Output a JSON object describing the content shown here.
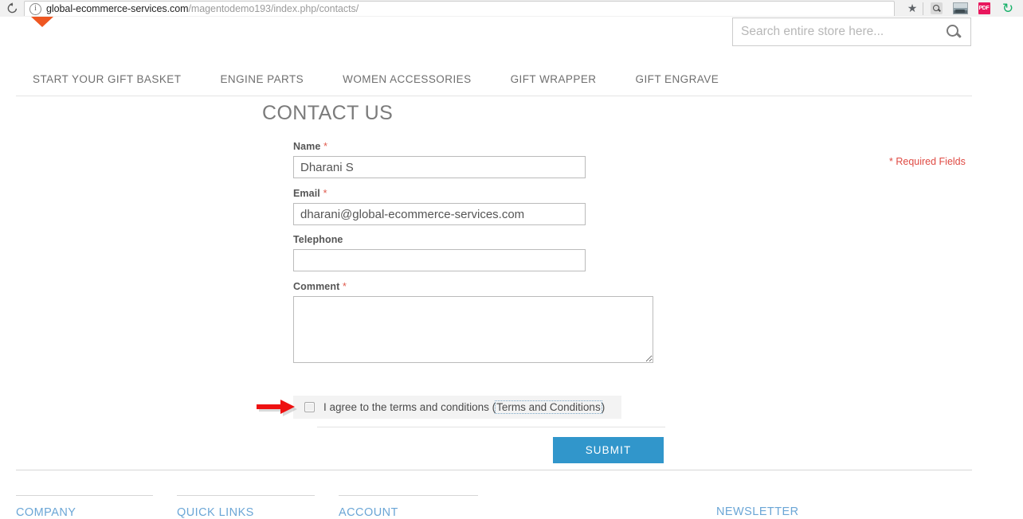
{
  "browser": {
    "reload_icon": "reload-icon",
    "info_icon": "info-icon",
    "url_domain": "global-ecommerce-services.com",
    "url_path": "/magentodemo193/index.php/contacts/",
    "star_icon": "★",
    "extensions": [
      {
        "name": "search-extension-icon"
      },
      {
        "name": "screenshot-extension-icon"
      },
      {
        "name": "pdf-extension-icon",
        "label": "PDF"
      },
      {
        "name": "green-refresh-extension-icon",
        "label": "↻"
      }
    ]
  },
  "header": {
    "search": {
      "placeholder": "Search entire store here...",
      "value": "",
      "button_icon": "search-icon"
    },
    "nav": [
      {
        "label": "START YOUR GIFT BASKET"
      },
      {
        "label": "ENGINE PARTS"
      },
      {
        "label": "WOMEN ACCESSORIES"
      },
      {
        "label": "GIFT WRAPPER"
      },
      {
        "label": "GIFT ENGRAVE"
      }
    ]
  },
  "main": {
    "title": "CONTACT US",
    "required_note": "* Required Fields",
    "fields": {
      "name": {
        "label": "Name",
        "required_mark": "*",
        "value": "Dharani S",
        "placeholder": ""
      },
      "email": {
        "label": "Email",
        "required_mark": "*",
        "value": "dharani@global-ecommerce-services.com",
        "placeholder": ""
      },
      "telephone": {
        "label": "Telephone",
        "value": "",
        "placeholder": ""
      },
      "comment": {
        "label": "Comment",
        "required_mark": "*",
        "value": "",
        "placeholder": ""
      }
    },
    "terms": {
      "checked": false,
      "text_before": "I agree to the terms and conditions (",
      "link_label": "Terms and Conditions",
      "text_after": ")"
    },
    "submit_label": "SUBMIT"
  },
  "annotation": {
    "arrow_color": "#ee1111",
    "points_to": "terms-checkbox"
  },
  "footer": {
    "columns": [
      {
        "label": "COMPANY"
      },
      {
        "label": "QUICK LINKS"
      },
      {
        "label": "ACCOUNT"
      },
      {
        "label": "NEWSLETTER"
      }
    ]
  },
  "colors": {
    "accent_blue": "#3196cb",
    "link_blue": "#6ba6d6",
    "required_red": "#df4a43",
    "logo_orange": "#ee5722"
  }
}
